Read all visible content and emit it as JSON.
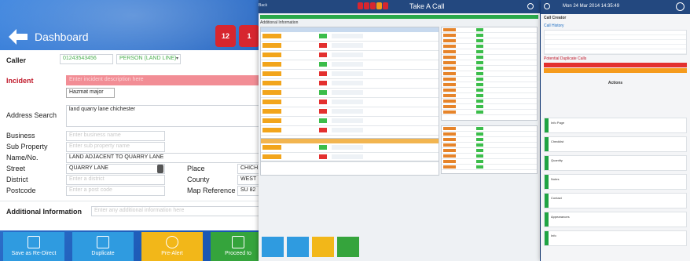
{
  "left": {
    "header_title": "Dashboard",
    "alert_bells": [
      "12",
      "1"
    ],
    "labels": {
      "caller": "Caller",
      "incident": "Incident",
      "address_search": "Address Search",
      "business": "Business",
      "sub_property": "Sub Property",
      "name_no": "Name/No.",
      "street": "Street",
      "district": "District",
      "postcode": "Postcode",
      "place": "Place",
      "county": "County",
      "map_reference": "Map Reference",
      "additional_information": "Additional Information"
    },
    "values": {
      "caller_number": "01243543456",
      "caller_type": "PERSON (LAND LINE)",
      "incident_placeholder": "Enter incident description here",
      "incident_suggestion": "Hazmat major",
      "address_search": "land quarry lane chichester",
      "business_placeholder": "Enter business name",
      "sub_property_placeholder": "Enter sub property name",
      "name_no": "LAND ADJACENT TO QUARRY LANE",
      "street": "QUARRY LANE",
      "district_placeholder": "Enter a district",
      "postcode_placeholder": "Enter a post code",
      "place": "CHICH",
      "county": "WEST",
      "map_reference": "SU 82",
      "additional_placeholder": "Enter any additional information here"
    },
    "buttons": [
      {
        "label": "Save as Re-Direct",
        "color": "#2f9be0"
      },
      {
        "label": "Duplicate",
        "color": "#2f9be0"
      },
      {
        "label": "Pre-Alert",
        "color": "#f2b719"
      },
      {
        "label": "Proceed to",
        "color": "#35a43c"
      }
    ]
  },
  "center": {
    "header_title": "Take A Call",
    "back_label": "Back",
    "section_label": "Additional Information"
  },
  "right": {
    "header_time": "Mon 24 Mar 2014 14:35:49",
    "call_creator_label": "Call Creator",
    "call_history_label": "Call History",
    "potential_duplicate_label": "Potential Duplicate Calls",
    "actions_label": "Actions",
    "action_items": [
      "Info Page",
      "Checklist",
      "Quantity",
      "Notes",
      "Contact",
      "Appearances",
      "Info"
    ]
  },
  "colors": {
    "accent_red": "#d7262f",
    "accent_green": "#35a43c",
    "accent_orange": "#f2b719",
    "header_navy": "#23487f"
  }
}
